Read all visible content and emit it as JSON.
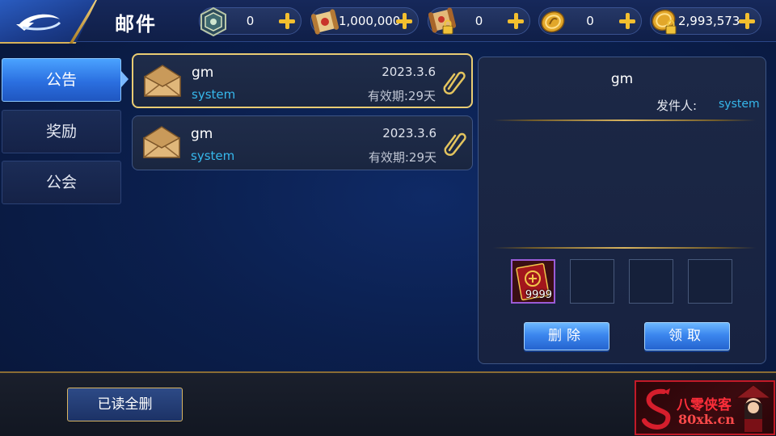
{
  "header": {
    "title": "邮件",
    "resources": [
      {
        "icon": "shield-token-icon",
        "value": "0"
      },
      {
        "icon": "scroll-icon",
        "value": "1,000,000"
      },
      {
        "icon": "locked-scroll-icon",
        "value": "0"
      },
      {
        "icon": "gold-coin-icon",
        "value": "0"
      },
      {
        "icon": "locked-coin-icon",
        "value": "2,993,573"
      }
    ]
  },
  "tabs": [
    {
      "label": "公告",
      "active": true
    },
    {
      "label": "奖励",
      "active": false
    },
    {
      "label": "公会",
      "active": false
    }
  ],
  "mails": [
    {
      "sender_name": "gm",
      "from": "system",
      "date": "2023.3.6",
      "expire": "有效期:29天",
      "selected": true
    },
    {
      "sender_name": "gm",
      "from": "system",
      "date": "2023.3.6",
      "expire": "有效期:29天",
      "selected": false
    }
  ],
  "detail": {
    "title": "gm",
    "sender_label": "发件人:",
    "sender": "system",
    "attachments": [
      {
        "item": "red-book-icon",
        "quantity": "9999"
      },
      {
        "item": "empty",
        "quantity": ""
      },
      {
        "item": "empty",
        "quantity": ""
      },
      {
        "item": "empty",
        "quantity": ""
      }
    ],
    "delete_label": "删除",
    "claim_label": "领取"
  },
  "footer": {
    "delete_read_label": "已读全删"
  },
  "watermark": {
    "text_cn": "八零侠客",
    "text_url": "80xk.cn"
  },
  "colors": {
    "accent_gold": "#e9cc73",
    "link_cyan": "#36b8ec",
    "tab_active": "#2b6fe0",
    "watermark_red": "#c21a28"
  }
}
